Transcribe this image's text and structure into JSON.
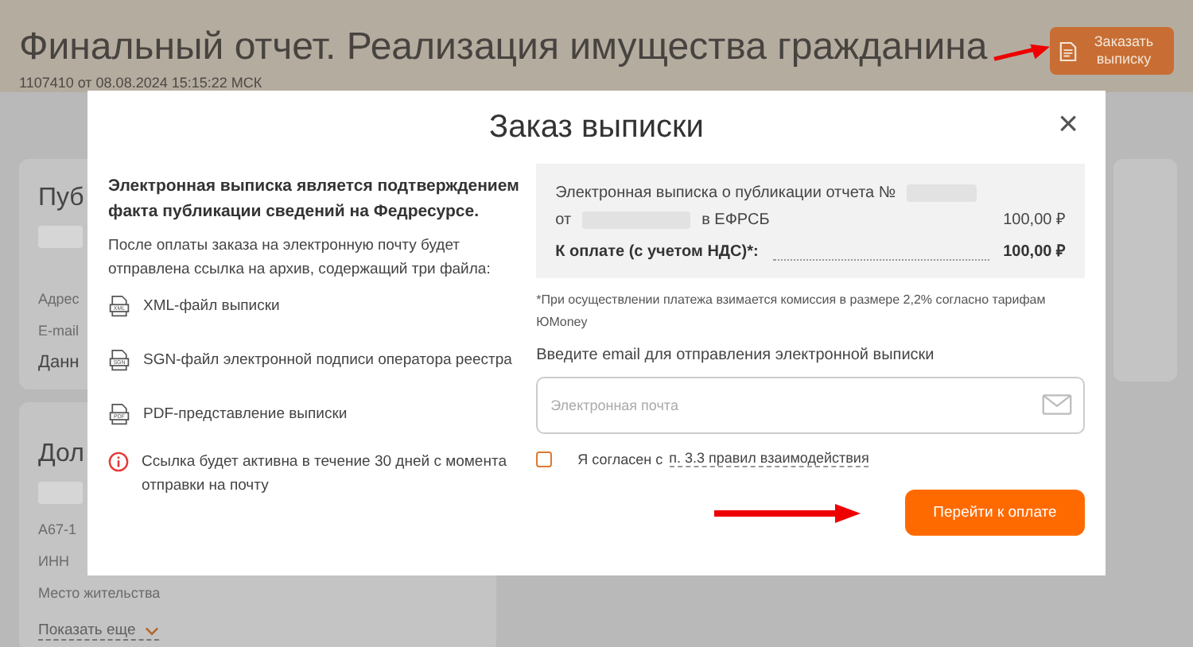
{
  "page": {
    "title": "Финальный отчет. Реализация имущества гражданина",
    "subtitle": "1107410 от 08.08.2024 15:15:22 МСК",
    "order_button": "Заказать выписку"
  },
  "cards": [
    {
      "heading": "Пуб",
      "lines": [
        "Адрес",
        "E-mail"
      ],
      "subheading": "Данн"
    },
    {
      "heading": "Дол",
      "lines": [
        "А67-1",
        "ИНН",
        "Место жительства"
      ],
      "more": "Показать еще"
    }
  ],
  "dialog": {
    "title": "Заказ выписки",
    "close": "×",
    "intro": "Электронная выписка является подтверждением факта публикации сведений на Федресурсе.",
    "description": "После оплаты заказа на электронную почту будет отправлена ссылка на архив, содержащий три файла:",
    "files": [
      {
        "label": "XML-файл выписки",
        "badge": "XML"
      },
      {
        "label": "SGN-файл электронной подписи оператора реестра",
        "badge": "SGN"
      },
      {
        "label": "PDF-представление выписки",
        "badge": "PDF"
      }
    ],
    "notice": "Ссылка будет активна в течение 30 дней с момента отправки на почту",
    "summary": {
      "item_line1": "Электронная выписка о публикации отчета №",
      "item_from": "от",
      "item_register": "в ЕФРСБ",
      "item_price": "100,00 ₽",
      "total_label": "К оплате (с учетом НДС)*:",
      "total_price": "100,00 ₽"
    },
    "footnote": "*При осуществлении платежа взимается комиссия в размере 2,2% согласно тарифам ЮMoney",
    "email_label": "Введите email для отправления электронной выписки",
    "email_placeholder": "Электронная почта",
    "agree": {
      "checked": false,
      "text": "Я согласен с",
      "link": "п. 3.3 правил взаимодействия"
    },
    "pay_button": "Перейти к оплате"
  }
}
